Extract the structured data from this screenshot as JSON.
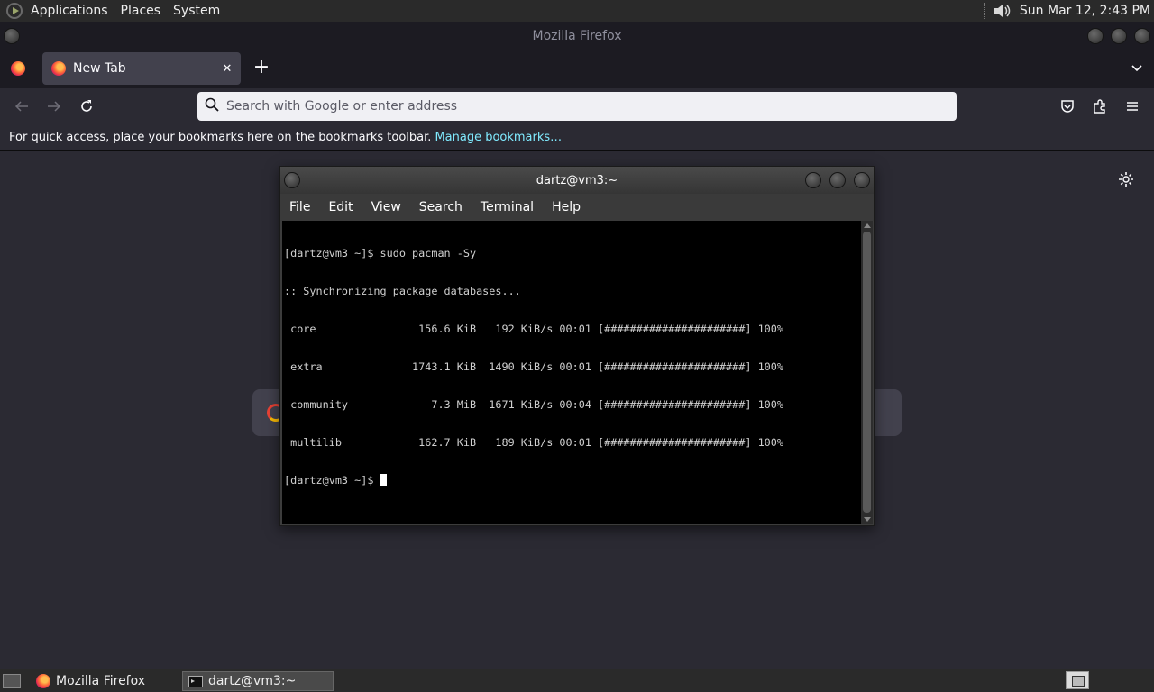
{
  "top_panel": {
    "menus": [
      "Applications",
      "Places",
      "System"
    ],
    "clock": "Sun Mar 12,  2:43 PM"
  },
  "firefox": {
    "window_title": "Mozilla Firefox",
    "tab": {
      "label": "New Tab",
      "close": "✕"
    },
    "new_tab_symbol": "+",
    "url_placeholder": "Search with Google or enter address",
    "bookmarks_text": "For quick access, place your bookmarks here on the bookmarks toolbar.",
    "bookmarks_link": "Manage bookmarks…"
  },
  "terminal": {
    "title": "dartz@vm3:~",
    "menus": [
      "File",
      "Edit",
      "View",
      "Search",
      "Terminal",
      "Help"
    ],
    "lines": [
      "[dartz@vm3 ~]$ sudo pacman -Sy",
      ":: Synchronizing package databases...",
      " core                156.6 KiB   192 KiB/s 00:01 [######################] 100%",
      " extra              1743.1 KiB  1490 KiB/s 00:01 [######################] 100%",
      " community             7.3 MiB  1671 KiB/s 00:04 [######################] 100%",
      " multilib            162.7 KiB   189 KiB/s 00:01 [######################] 100%"
    ],
    "prompt": "[dartz@vm3 ~]$ "
  },
  "taskbar": {
    "tasks": [
      "Mozilla Firefox",
      "dartz@vm3:~"
    ]
  },
  "colors": {
    "firefox_bg": "#2b2a33",
    "link": "#80ebff",
    "terminal_bg": "#000000"
  }
}
